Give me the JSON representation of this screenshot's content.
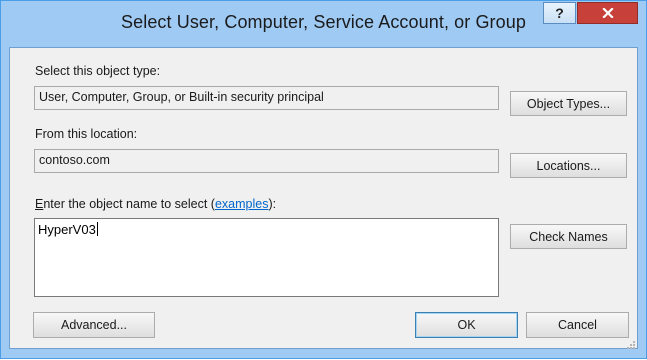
{
  "window": {
    "title": "Select User, Computer, Service Account, or Group",
    "help_label": "?",
    "close_label": "x"
  },
  "object_type": {
    "label": "Select this object type:",
    "value": "User, Computer, Group, or Built-in security principal",
    "button_label": "Object Types..."
  },
  "location": {
    "label": "From this location:",
    "value": "contoso.com",
    "button_label": "Locations..."
  },
  "object_name": {
    "label_prefix_mnemonic": "E",
    "label_prefix_rest": "nter the object name to select (",
    "examples_link": "examples",
    "label_suffix": "):",
    "value": "HyperV03",
    "check_names_label": "Check Names"
  },
  "footer": {
    "advanced_label": "Advanced...",
    "ok_label": "OK",
    "cancel_label": "Cancel"
  },
  "colors": {
    "window_frame": "#9fcaf4",
    "close_button": "#c7413a",
    "link": "#0066cc"
  }
}
